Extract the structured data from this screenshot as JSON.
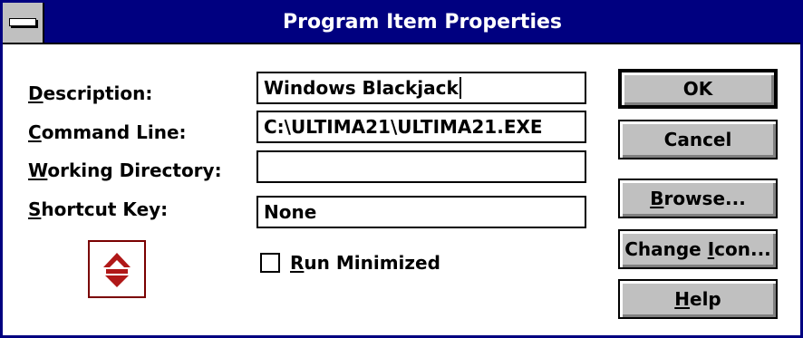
{
  "window": {
    "title": "Program Item Properties"
  },
  "form": {
    "description": {
      "label_key": "D",
      "label_rest": "escription:",
      "value": "Windows Blackjack"
    },
    "command_line": {
      "label_key": "C",
      "label_rest": "ommand Line:",
      "value": "C:\\ULTIMA21\\ULTIMA21.EXE"
    },
    "working_directory": {
      "label_key": "W",
      "label_rest": "orking Directory:",
      "value": ""
    },
    "shortcut_key": {
      "label_key": "S",
      "label_rest": "hortcut Key:",
      "value": "None"
    },
    "run_minimized": {
      "label_key": "R",
      "label_rest": "un Minimized",
      "checked": false
    }
  },
  "buttons": {
    "ok": {
      "label": "OK"
    },
    "cancel": {
      "label": "Cancel"
    },
    "browse": {
      "label_key": "B",
      "label_rest": "rowse..."
    },
    "change_icon": {
      "label_pre": "Change ",
      "label_key": "I",
      "label_rest": "con..."
    },
    "help": {
      "label_key": "H",
      "label_rest": "elp"
    }
  },
  "icon": {
    "name": "program-icon",
    "color": "#b01818"
  },
  "colors": {
    "titlebar": "#000080",
    "button_face": "#c0c0c0"
  }
}
